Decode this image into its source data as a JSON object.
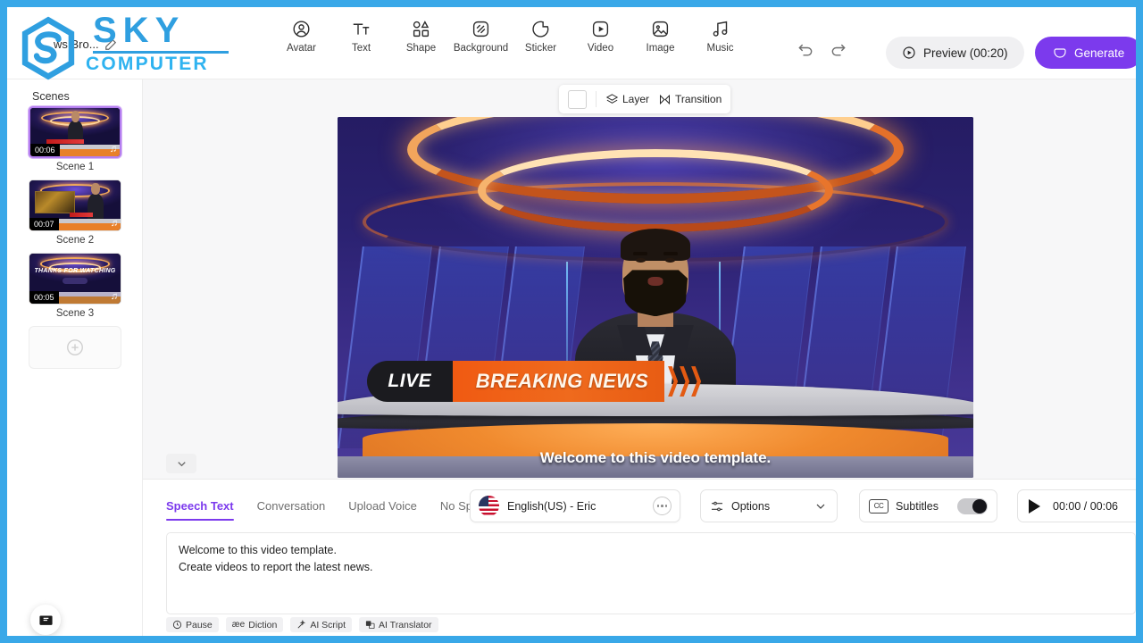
{
  "window": {
    "border_color": "#39a8e8"
  },
  "watermark": {
    "line1": "SKY",
    "line2": "COMPUTER",
    "color": "#2f9fe0"
  },
  "header": {
    "project_title": "ws Bro...",
    "edit_icon": "pencil-icon",
    "tools": [
      {
        "label": "Avatar",
        "icon": "avatar-icon"
      },
      {
        "label": "Text",
        "icon": "text-icon"
      },
      {
        "label": "Shape",
        "icon": "shape-icon"
      },
      {
        "label": "Background",
        "icon": "background-icon"
      },
      {
        "label": "Sticker",
        "icon": "sticker-icon"
      },
      {
        "label": "Video",
        "icon": "video-icon"
      },
      {
        "label": "Image",
        "icon": "image-icon"
      },
      {
        "label": "Music",
        "icon": "music-icon"
      }
    ],
    "undo": "undo-icon",
    "redo": "redo-icon",
    "preview_label": "Preview (00:20)",
    "generate_label": "Generate",
    "generate_color": "#7c3aed"
  },
  "sidebar": {
    "title": "Scenes",
    "scenes": [
      {
        "name": "Scene 1",
        "duration": "00:06",
        "active": true
      },
      {
        "name": "Scene 2",
        "duration": "00:07",
        "active": false
      },
      {
        "name": "Scene 3",
        "duration": "00:05",
        "active": false
      }
    ],
    "add_scene_icon": "plus-circle-icon"
  },
  "canvas": {
    "toolbar": {
      "color_swatch": "#ffffff",
      "layer_label": "Layer",
      "transition_label": "Transition"
    },
    "stage": {
      "live_badge": "LIVE",
      "headline": "BREAKING NEWS",
      "subtitle": "Welcome to this video template.",
      "thanks_text": "THANKS FOR WATCHING"
    },
    "collapse_icon": "chevron-down-icon"
  },
  "bottom": {
    "tabs": [
      {
        "label": "Speech Text",
        "active": true
      },
      {
        "label": "Conversation",
        "active": false
      },
      {
        "label": "Upload Voice",
        "active": false
      },
      {
        "label": "No Speech",
        "active": false
      }
    ],
    "voice": {
      "name": "English(US) - Eric",
      "flag": "us-flag-icon",
      "more": "more-options-icon"
    },
    "options_label": "Options",
    "subtitles_label": "Subtitles",
    "subtitles_on": true,
    "time_display": "00:00 / 00:06",
    "script": {
      "line1": "Welcome to this video template.",
      "line2": "Create videos to report the latest news."
    },
    "actions": [
      {
        "label": "Pause",
        "icon": "clock-icon"
      },
      {
        "label": "Diction",
        "icon": "diction-icon"
      },
      {
        "label": "AI Script",
        "icon": "magic-wand-icon"
      },
      {
        "label": "AI Translator",
        "icon": "translate-icon"
      }
    ],
    "feedback_icon": "message-icon"
  }
}
